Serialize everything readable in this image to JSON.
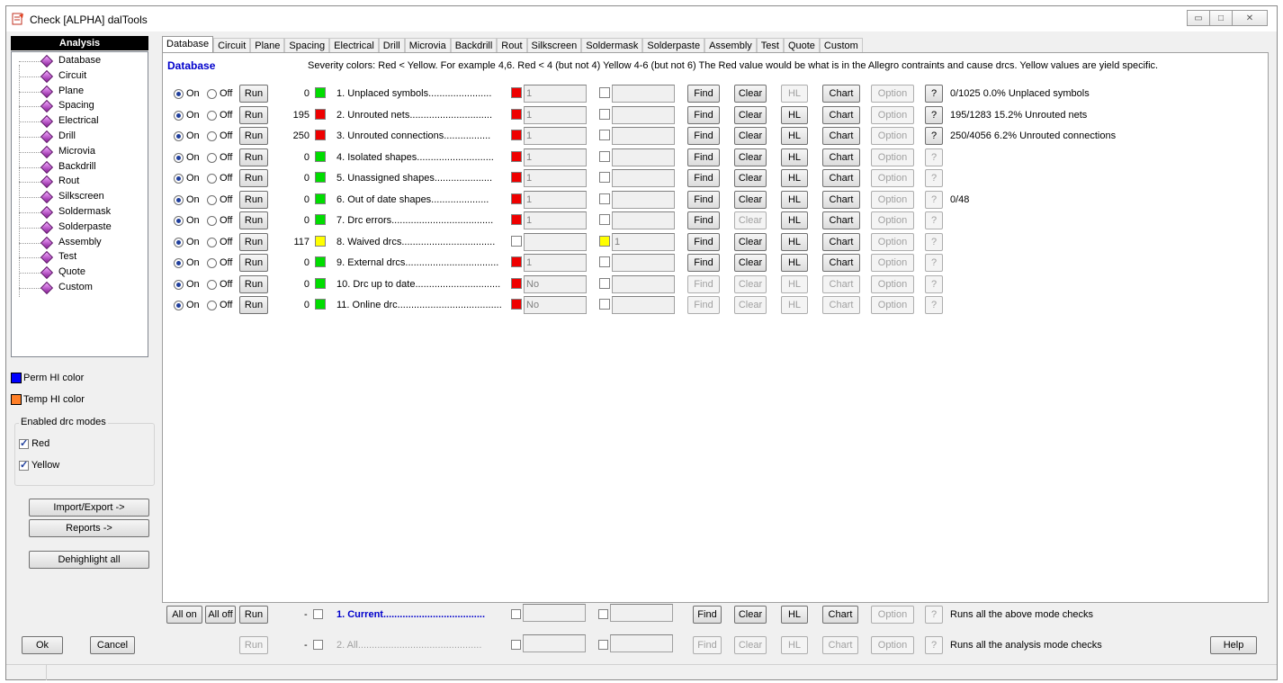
{
  "window": {
    "title": "Check [ALPHA] dalTools"
  },
  "left": {
    "header": "Analysis",
    "tree": [
      "Database",
      "Circuit",
      "Plane",
      "Spacing",
      "Electrical",
      "Drill",
      "Microvia",
      "Backdrill",
      "Rout",
      "Silkscreen",
      "Soldermask",
      "Solderpaste",
      "Assembly",
      "Test",
      "Quote",
      "Custom"
    ],
    "perm_color_label": "Perm HI color",
    "temp_color_label": "Temp HI color",
    "perm_color": "#0000ff",
    "temp_color": "#ff7f27",
    "modes_title": "Enabled drc modes",
    "mode_red": "Red",
    "mode_yellow": "Yellow",
    "import_export": "Import/Export ->",
    "reports": "Reports ->",
    "dehighlight": "Dehighlight all"
  },
  "tabs": [
    "Database",
    "Circuit",
    "Plane",
    "Spacing",
    "Electrical",
    "Drill",
    "Microvia",
    "Backdrill",
    "Rout",
    "Silkscreen",
    "Soldermask",
    "Solderpaste",
    "Assembly",
    "Test",
    "Quote",
    "Custom"
  ],
  "section": {
    "title": "Database",
    "severity": "Severity colors: Red < Yellow.  For example 4,6.  Red < 4 (but not 4) Yellow 4-6 (but not 6) The Red value would be what is in the Allegro contraints and cause drcs.  Yellow values are yield specific."
  },
  "labels": {
    "on": "On",
    "off": "Off",
    "run": "Run",
    "find": "Find",
    "clear": "Clear",
    "hl": "HL",
    "chart": "Chart",
    "option": "Option",
    "help_q": "?"
  },
  "rows": [
    {
      "count": "0",
      "status": "#00dd00",
      "label": "1.  Unplaced symbols.......................",
      "red_val": "1",
      "yellow_val": "",
      "red_on": true,
      "yellow_on": false,
      "result": "0/1025 0.0% Unplaced symbols",
      "find": true,
      "clear": true,
      "hl": false,
      "chart": true,
      "q": true
    },
    {
      "count": "195",
      "status": "#ee0000",
      "label": "2.  Unrouted nets..............................",
      "red_val": "1",
      "yellow_val": "",
      "red_on": true,
      "yellow_on": false,
      "result": "195/1283 15.2% Unrouted nets",
      "find": true,
      "clear": true,
      "hl": true,
      "chart": true,
      "q": true
    },
    {
      "count": "250",
      "status": "#ee0000",
      "label": "3.  Unrouted connections.................",
      "red_val": "1",
      "yellow_val": "",
      "red_on": true,
      "yellow_on": false,
      "result": "250/4056 6.2% Unrouted connections",
      "find": true,
      "clear": true,
      "hl": true,
      "chart": true,
      "q": true
    },
    {
      "count": "0",
      "status": "#00dd00",
      "label": "4.  Isolated shapes............................",
      "red_val": "1",
      "yellow_val": "",
      "red_on": true,
      "yellow_on": false,
      "result": "",
      "find": true,
      "clear": true,
      "hl": true,
      "chart": true,
      "q": false
    },
    {
      "count": "0",
      "status": "#00dd00",
      "label": "5.  Unassigned shapes.....................",
      "red_val": "1",
      "yellow_val": "",
      "red_on": true,
      "yellow_on": false,
      "result": "",
      "find": true,
      "clear": true,
      "hl": true,
      "chart": true,
      "q": false
    },
    {
      "count": "0",
      "status": "#00dd00",
      "label": "6.  Out of date shapes.....................",
      "red_val": "1",
      "yellow_val": "",
      "red_on": true,
      "yellow_on": false,
      "result": "0/48",
      "find": true,
      "clear": true,
      "hl": true,
      "chart": true,
      "q": false
    },
    {
      "count": "0",
      "status": "#00dd00",
      "label": "7.  Drc errors.....................................",
      "red_val": "1",
      "yellow_val": "",
      "red_on": true,
      "yellow_on": false,
      "result": "",
      "find": true,
      "clear": false,
      "hl": true,
      "chart": true,
      "q": false
    },
    {
      "count": "117",
      "status": "#ffff00",
      "label": "8.  Waived drcs..................................",
      "red_val": "",
      "yellow_val": "1",
      "red_on": false,
      "yellow_on": true,
      "result": "",
      "find": true,
      "clear": true,
      "hl": true,
      "chart": true,
      "q": false
    },
    {
      "count": "0",
      "status": "#00dd00",
      "label": "9.  External drcs..................................",
      "red_val": "1",
      "yellow_val": "",
      "red_on": true,
      "yellow_on": false,
      "result": "",
      "find": true,
      "clear": true,
      "hl": true,
      "chart": true,
      "q": false
    },
    {
      "count": "0",
      "status": "#00dd00",
      "label": "10.  Drc up to date...............................",
      "red_val": "No",
      "yellow_val": "",
      "red_on": true,
      "yellow_on": false,
      "result": "",
      "find": false,
      "clear": false,
      "hl": false,
      "chart": false,
      "q": false
    },
    {
      "count": "0",
      "status": "#00dd00",
      "label": "11.  Online drc......................................",
      "red_val": "No",
      "yellow_val": "",
      "red_on": true,
      "yellow_on": false,
      "result": "",
      "find": false,
      "clear": false,
      "hl": false,
      "chart": false,
      "q": false
    }
  ],
  "bottom": {
    "all_on": "All on",
    "all_off": "All off",
    "run": "Run",
    "current_prefix": "-",
    "current_label": "1.  Current.....................................",
    "current_result": "Runs all the above mode checks",
    "all_prefix": "-",
    "all_label": "2.  All.............................................",
    "all_result": "Runs all the analysis mode checks"
  },
  "footer": {
    "ok": "Ok",
    "cancel": "Cancel",
    "help": "Help"
  }
}
